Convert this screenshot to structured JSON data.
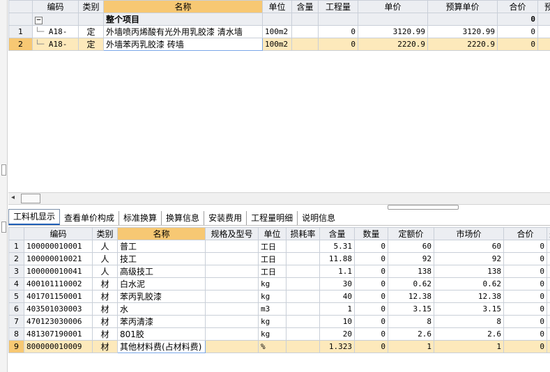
{
  "top": {
    "headers": [
      "",
      "编码",
      "类别",
      "名称",
      "单位",
      "含量",
      "工程量",
      "单价",
      "预算单价",
      "合价",
      "预"
    ],
    "group_row": {
      "toggle": "−",
      "name": "整个项目",
      "total": "0"
    },
    "rows": [
      {
        "n": "1",
        "code": "A18-",
        "type": "定",
        "name": "外墙喷丙烯酸有光外用乳胶漆 清水墙",
        "unit": "100m2",
        "content": "",
        "qty": "0",
        "price": "3120.99",
        "budget": "3120.99",
        "total": "0"
      },
      {
        "n": "2",
        "code": "A18-",
        "type": "定",
        "name": "外墙苯丙乳胶漆 砖墙",
        "unit": "100m2",
        "content": "",
        "qty": "0",
        "price": "2220.9",
        "budget": "2220.9",
        "total": "0"
      }
    ]
  },
  "tabs": [
    "工料机显示",
    "查看单价构成",
    "标准换算",
    "换算信息",
    "安装费用",
    "工程量明细",
    "说明信息"
  ],
  "bottom": {
    "headers": [
      "",
      "编码",
      "类别",
      "名称",
      "规格及型号",
      "单位",
      "损耗率",
      "含量",
      "数量",
      "定额价",
      "市场价",
      "合价",
      "是"
    ],
    "rows": [
      {
        "n": "1",
        "code": "100000010001",
        "type": "人",
        "name": "普工",
        "spec": "",
        "unit": "工日",
        "loss": "",
        "content": "5.31",
        "qty": "0",
        "quota": "60",
        "market": "60",
        "total": "0"
      },
      {
        "n": "2",
        "code": "100000010021",
        "type": "人",
        "name": "技工",
        "spec": "",
        "unit": "工日",
        "loss": "",
        "content": "11.88",
        "qty": "0",
        "quota": "92",
        "market": "92",
        "total": "0"
      },
      {
        "n": "3",
        "code": "100000010041",
        "type": "人",
        "name": "高级技工",
        "spec": "",
        "unit": "工日",
        "loss": "",
        "content": "1.1",
        "qty": "0",
        "quota": "138",
        "market": "138",
        "total": "0"
      },
      {
        "n": "4",
        "code": "400101110002",
        "type": "材",
        "name": "白水泥",
        "spec": "",
        "unit": "kg",
        "loss": "",
        "content": "30",
        "qty": "0",
        "quota": "0.62",
        "market": "0.62",
        "total": "0"
      },
      {
        "n": "5",
        "code": "401701150001",
        "type": "材",
        "name": "苯丙乳胶漆",
        "spec": "",
        "unit": "kg",
        "loss": "",
        "content": "40",
        "qty": "0",
        "quota": "12.38",
        "market": "12.38",
        "total": "0"
      },
      {
        "n": "6",
        "code": "403501030003",
        "type": "材",
        "name": "水",
        "spec": "",
        "unit": "m3",
        "loss": "",
        "content": "1",
        "qty": "0",
        "quota": "3.15",
        "market": "3.15",
        "total": "0"
      },
      {
        "n": "7",
        "code": "470123030006",
        "type": "材",
        "name": "苯丙清漆",
        "spec": "",
        "unit": "kg",
        "loss": "",
        "content": "10",
        "qty": "0",
        "quota": "8",
        "market": "8",
        "total": "0"
      },
      {
        "n": "8",
        "code": "481307190001",
        "type": "材",
        "name": "801胶",
        "spec": "",
        "unit": "kg",
        "loss": "",
        "content": "20",
        "qty": "0",
        "quota": "2.6",
        "market": "2.6",
        "total": "0"
      },
      {
        "n": "9",
        "code": "800000010009",
        "type": "材",
        "name": "其他材料费(占材料费)",
        "spec": "",
        "unit": "%",
        "loss": "",
        "content": "1.323",
        "qty": "0",
        "quota": "1",
        "market": "1",
        "total": "0"
      }
    ]
  },
  "scroll": {
    "left_arrow": "◂"
  }
}
